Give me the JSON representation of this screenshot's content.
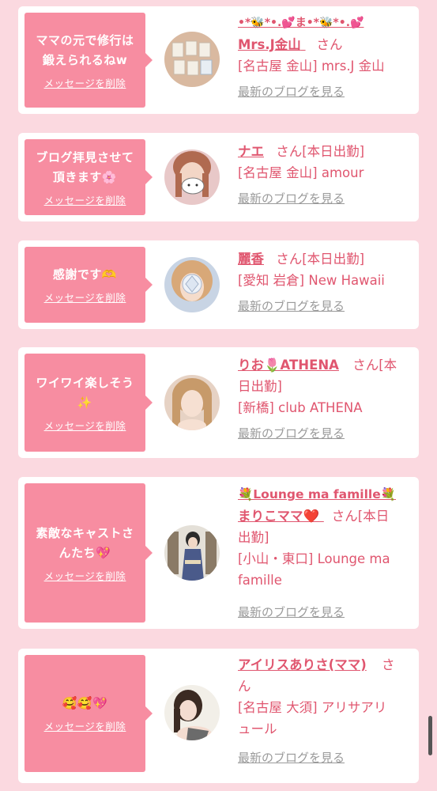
{
  "cards": [
    {
      "message_line1": "ママの元で修行は",
      "message_line2": "鍛えられるねw",
      "delete_label": "メッセージを削除",
      "name_prefix": "•*🐝*•.💕ま•*🐝*•.💕",
      "name": "Mrs.J金山",
      "san": "さん",
      "status": "",
      "shop": "[名古屋 金山] mrs.J 金山",
      "blog_label": "最新のブログを見る"
    },
    {
      "message_line1": "ブログ拝見させて",
      "message_line2": "頂きます🌸",
      "delete_label": "メッセージを削除",
      "name": "ナエ",
      "san": "さん",
      "status": "[本日出勤]",
      "shop": "[名古屋 金山] amour",
      "blog_label": "最新のブログを見る"
    },
    {
      "message_line1": "感謝です🫶",
      "message_line2": "",
      "delete_label": "メッセージを削除",
      "name": "麗香",
      "san": "さん",
      "status": "[本日出勤]",
      "shop": "[愛知 岩倉] New Hawaii",
      "blog_label": "最新のブログを見る"
    },
    {
      "message_line1": "ワイワイ楽しそう",
      "message_line2": "✨",
      "delete_label": "メッセージを削除",
      "name": "りお🌷ATHENA",
      "san": "さん[本",
      "status": "日出勤]",
      "shop": "[新橋] club ATHENA",
      "blog_label": "最新のブログを見る"
    },
    {
      "message_line1": "素敵なキャストさ",
      "message_line2": "んたち💖",
      "delete_label": "メッセージを削除",
      "name_line1": "💐Lounge ma famille💐",
      "name": "まりこママ❤️",
      "san": "さん[本日",
      "status": "出勤]",
      "shop_line1": "[小山・東口] Lounge ma",
      "shop_line2": "famille",
      "blog_label": "最新のブログを見る"
    },
    {
      "message_line1": "🥰🥰💖",
      "message_line2": "",
      "delete_label": "メッセージを削除",
      "name": "アイリスありさ(ママ)",
      "san": "さ",
      "status": "ん",
      "shop_line1": "[名古屋 大須] アリサアリ",
      "shop_line2": "ュール",
      "blog_label": "最新のブログを見る"
    }
  ],
  "colors": {
    "background": "#fbd9e0",
    "card": "#ffffff",
    "bubble": "#f78da1",
    "accent_text": "#e0566f",
    "muted_link": "#9a9a9a"
  },
  "icons": [
    "avatar-photo",
    "scrollbar-thumb"
  ]
}
